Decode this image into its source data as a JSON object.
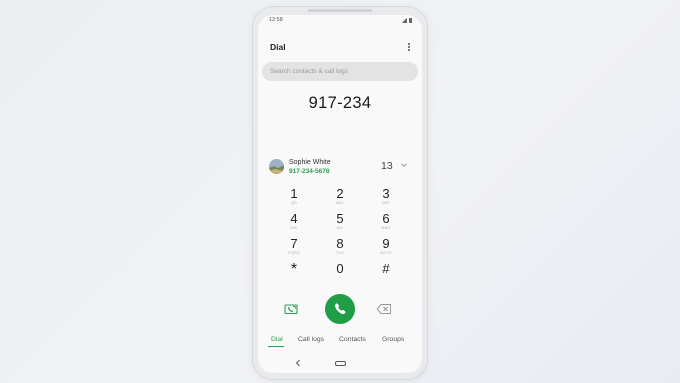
{
  "status": {
    "time": "12:58"
  },
  "header": {
    "title": "Dial"
  },
  "search": {
    "placeholder": "Search contacts & call logs"
  },
  "dialed_number": "917-234",
  "suggestion": {
    "name": "Sophie White",
    "number": "917-234-5678",
    "match_count": "13"
  },
  "keypad": [
    {
      "digit": "1",
      "letters": "QD"
    },
    {
      "digit": "2",
      "letters": "ABC"
    },
    {
      "digit": "3",
      "letters": "DEF"
    },
    {
      "digit": "4",
      "letters": "GHI"
    },
    {
      "digit": "5",
      "letters": "JKL"
    },
    {
      "digit": "6",
      "letters": "MNO"
    },
    {
      "digit": "7",
      "letters": "PQRS"
    },
    {
      "digit": "8",
      "letters": "TUV"
    },
    {
      "digit": "9",
      "letters": "WXYZ"
    },
    {
      "digit": "*",
      "letters": ""
    },
    {
      "digit": "0",
      "letters": "+"
    },
    {
      "digit": "#",
      "letters": ""
    }
  ],
  "actions": {
    "video_icon": "video-call-icon",
    "call_icon": "phone-icon",
    "backspace_icon": "backspace-icon",
    "call_color": "#1f9d47"
  },
  "tabs": [
    {
      "label": "Dial",
      "active": true
    },
    {
      "label": "Call logs",
      "active": false
    },
    {
      "label": "Contacts",
      "active": false
    },
    {
      "label": "Groups",
      "active": false
    }
  ],
  "accent_color": "#2e9b52"
}
